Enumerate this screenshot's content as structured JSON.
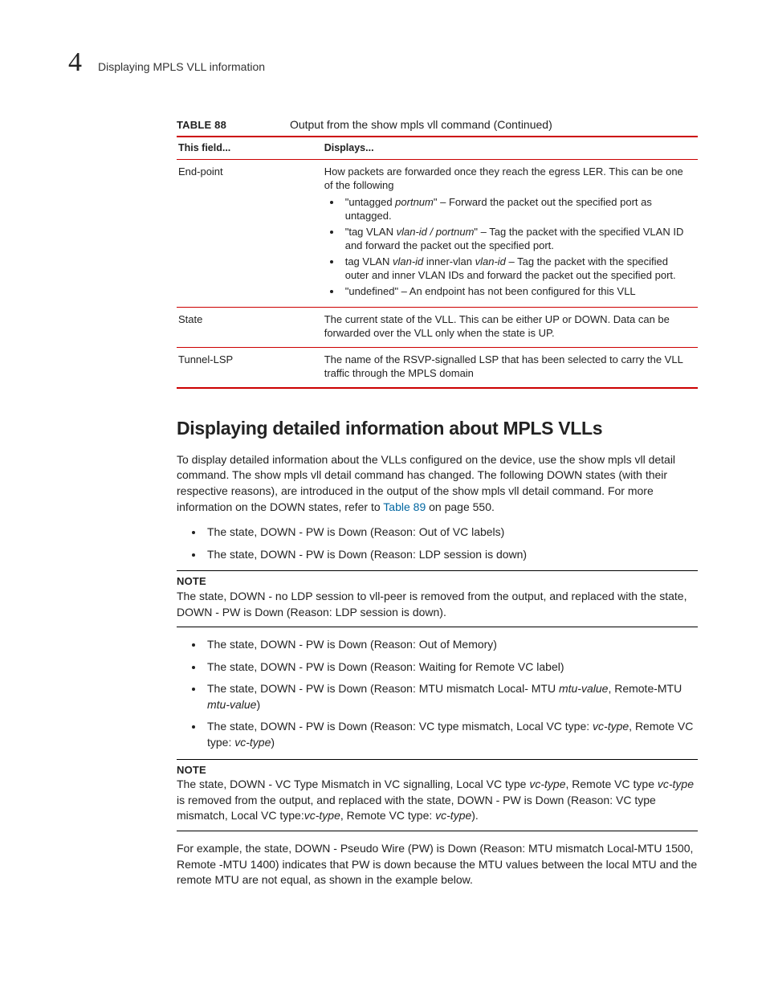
{
  "header": {
    "chapter_number": "4",
    "running_title": "Displaying MPLS VLL information"
  },
  "table": {
    "label": "TABLE 88",
    "title": "Output from the show mpls vll command  (Continued)",
    "head_col1": "This field...",
    "head_col2": "Displays...",
    "rows": {
      "r1_field": "End-point",
      "r1_intro": "How packets are forwarded once they reach the egress LER. This can be one of the following",
      "r1_b1a": "\"untagged ",
      "r1_b1b": "portnum",
      "r1_b1c": "\" – Forward the packet out the specified port as untagged.",
      "r1_b2a": "\"tag VLAN ",
      "r1_b2b": "vlan-id / portnum",
      "r1_b2c": "\" – Tag the packet with the specified VLAN ID and forward the packet out the specified port.",
      "r1_b3a": "tag VLAN ",
      "r1_b3b": "vlan-id",
      "r1_b3c": " inner-vlan ",
      "r1_b3d": "vlan-id",
      "r1_b3e": " – Tag the packet with the specified outer and inner VLAN IDs and forward the packet out the specified port.",
      "r1_b4": "\"undefined\" – An endpoint has not been configured for this VLL",
      "r2_field": "State",
      "r2_desc": "The current state of the VLL. This can be either UP or DOWN. Data can be forwarded over the VLL only when the state is UP.",
      "r3_field": "Tunnel-LSP",
      "r3_desc": "The name of the RSVP-signalled LSP that has been selected to carry the VLL traffic through the MPLS domain"
    }
  },
  "section": {
    "heading": "Displaying detailed information about MPLS VLLs",
    "p1a": "To display detailed information about the VLLs configured on the device, use the show mpls vll detail command. The show mpls vll detail command has changed. The following DOWN states (with their respective reasons), are introduced in the output of the show mpls vll detail command. For more information on the DOWN states, refer to ",
    "p1_link": "Table 89",
    "p1b": " on page 550.",
    "list1_i1": "The state, DOWN - PW is Down (Reason: Out of VC labels)",
    "list1_i2": "The state, DOWN - PW is Down (Reason: LDP session is down)",
    "note1_label": "NOTE",
    "note1_body": "The state, DOWN - no LDP session to vll-peer is removed from the output, and replaced with the state, DOWN - PW is Down (Reason: LDP session is down).",
    "list2_i1": "The state, DOWN - PW is Down (Reason: Out of Memory)",
    "list2_i2": "The state, DOWN - PW is Down (Reason: Waiting for Remote VC label)",
    "list2_i3a": "The state, DOWN - PW is Down (Reason: MTU mismatch Local- MTU ",
    "list2_i3b": "mtu-value",
    "list2_i3c": ", Remote-MTU ",
    "list2_i3d": "mtu-value",
    "list2_i3e": ")",
    "list2_i4a": "The state, DOWN - PW is Down (Reason: VC type mismatch, Local VC type: ",
    "list2_i4b": "vc-type",
    "list2_i4c": ", Remote VC type: ",
    "list2_i4d": "vc-type",
    "list2_i4e": ")",
    "note2_label": "NOTE",
    "note2_a": "The state, DOWN - VC Type Mismatch in VC signalling, Local VC type ",
    "note2_b": "vc-type",
    "note2_c": ", Remote VC type ",
    "note2_d": "vc-type",
    "note2_e": " is removed from the output, and replaced with the state, DOWN - PW is Down (Reason: VC type mismatch, Local VC type:",
    "note2_f": "vc-type",
    "note2_g": ", Remote VC type: ",
    "note2_h": "vc-type",
    "note2_i": ").",
    "p2": "For example, the state, DOWN - Pseudo Wire (PW) is Down (Reason: MTU mismatch Local-MTU 1500, Remote -MTU 1400) indicates that PW is down because the MTU values between the local MTU and the remote MTU are not equal, as shown in the example below."
  }
}
